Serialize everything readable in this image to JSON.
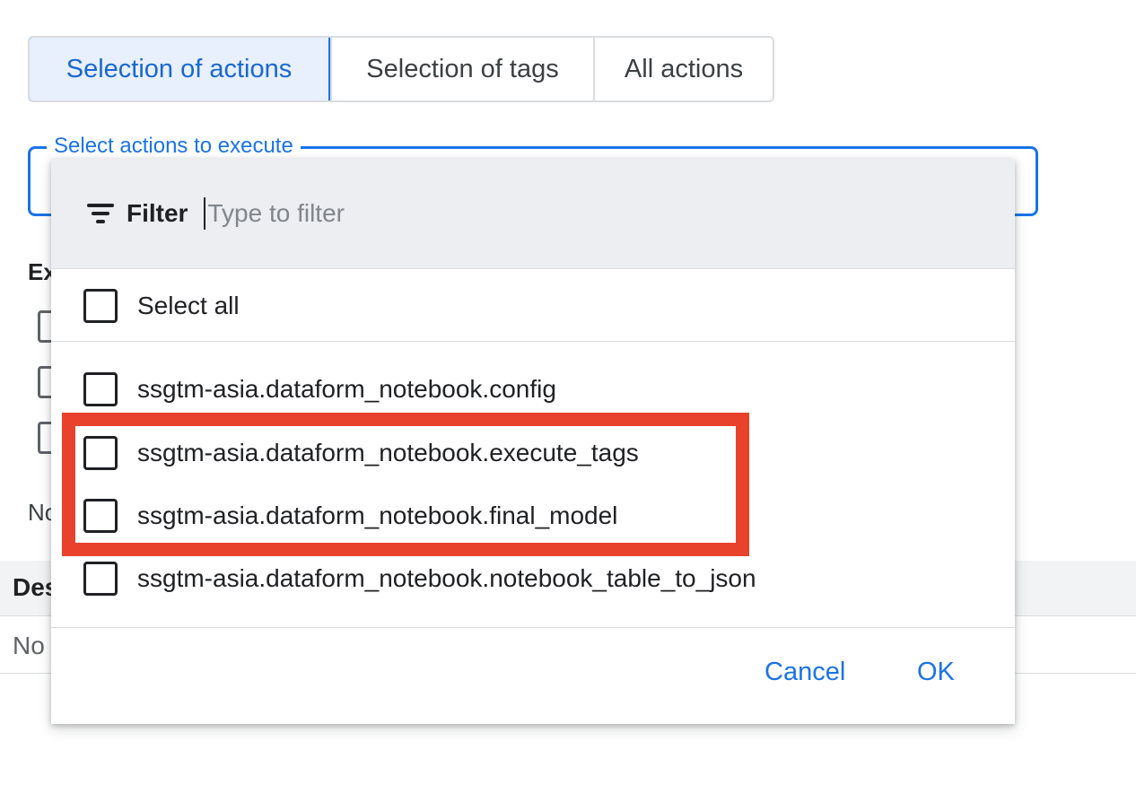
{
  "tabs": {
    "items": [
      {
        "label": "Selection of actions",
        "active": true
      },
      {
        "label": "Selection of tags",
        "active": false
      },
      {
        "label": "All actions",
        "active": false
      }
    ]
  },
  "field": {
    "label": "Select actions to execute"
  },
  "background": {
    "heading": "Ex",
    "note": "No",
    "table_header": "Des",
    "table_cell": "No"
  },
  "dropdown": {
    "filter_label": "Filter",
    "filter_placeholder": "Type to filter",
    "select_all": "Select all",
    "options": [
      {
        "label": "ssgtm-asia.dataform_notebook.config",
        "checked": false
      },
      {
        "label": "ssgtm-asia.dataform_notebook.execute_tags",
        "checked": false
      },
      {
        "label": "ssgtm-asia.dataform_notebook.final_model",
        "checked": false
      },
      {
        "label": "ssgtm-asia.dataform_notebook.notebook_table_to_json",
        "checked": false
      }
    ],
    "cancel": "Cancel",
    "ok": "OK"
  },
  "colors": {
    "accent": "#1a73e8",
    "highlight": "#e8412c"
  },
  "icons": {
    "filter": "filter-list-icon"
  }
}
